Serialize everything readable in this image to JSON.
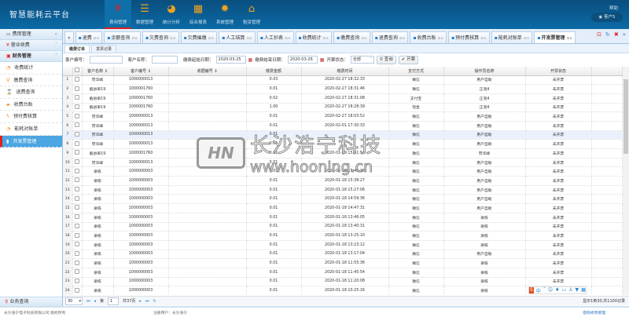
{
  "app": {
    "title": "智慧能耗云平台",
    "help": "帮助",
    "user": "客户5"
  },
  "nav": [
    {
      "label": "费用管理",
      "icon": "yen-icon",
      "glyph": "¥",
      "active": true
    },
    {
      "label": "数据管理",
      "icon": "database-icon",
      "glyph": "☰"
    },
    {
      "label": "统计分析",
      "icon": "pie-chart-icon",
      "glyph": "◕"
    },
    {
      "label": "综合报表",
      "icon": "table-icon",
      "glyph": "▦"
    },
    {
      "label": "系统管理",
      "icon": "gear-icon",
      "glyph": "✹"
    },
    {
      "label": "租赁管理",
      "icon": "home-icon",
      "glyph": "⌂"
    }
  ],
  "sidebar": {
    "header": "费用管理",
    "groups": [
      {
        "label": "营业收费"
      },
      {
        "label": "财务管理"
      }
    ],
    "items": [
      {
        "label": "收费统计"
      },
      {
        "label": "缴费查询"
      },
      {
        "label": "退费查询"
      },
      {
        "label": "收费台账"
      },
      {
        "label": "预付费核算"
      },
      {
        "label": "能耗对账单"
      },
      {
        "label": "开发票管理",
        "active": true
      }
    ],
    "bottom": "业务查询"
  },
  "tabs": [
    {
      "label": "退费"
    },
    {
      "label": "余额查询"
    },
    {
      "label": "欠费查询"
    },
    {
      "label": "欠费催缴"
    },
    {
      "label": "人工结算"
    },
    {
      "label": "人工抄表"
    },
    {
      "label": "收费统计"
    },
    {
      "label": "缴费查询"
    },
    {
      "label": "退费查询"
    },
    {
      "label": "收费台账"
    },
    {
      "label": "预付费核算"
    },
    {
      "label": "能耗对账单"
    },
    {
      "label": "开发票管理",
      "active": true
    }
  ],
  "subtabs": [
    {
      "label": "缴费订单",
      "active": true
    },
    {
      "label": "发票记录"
    }
  ],
  "filter": {
    "customer_no_label": "客户编号：",
    "customer_no": "",
    "customer_name_label": "客户名称：",
    "customer_name": "",
    "start_label": "缴费起始日期：",
    "start": "2020-03-25",
    "end_label": "缴费结束日期：",
    "end": "2020-03-26",
    "status_label": "开票状态：",
    "status": "全部",
    "query": "查询",
    "invoice": "开票"
  },
  "table": {
    "columns": [
      "客户名称 ↕",
      "客户编号 ↕",
      "收据编号 ↕",
      "缴费金额",
      "缴费时间",
      "支付方式",
      "操作员名称",
      "开票状态"
    ],
    "rows": [
      [
        "赞华峰",
        "1000000013",
        "",
        "0.03",
        "2020-02-27 18:32:33",
        "微信",
        "用户自助",
        "未开票"
      ],
      [
        "截进单19",
        "1000001760",
        "",
        "0.01",
        "2020-02-27 18:31:46",
        "微信",
        "正泡4",
        "未开票"
      ],
      [
        "截进单19",
        "1000001760",
        "",
        "0.02",
        "2020-02-27 18:31:08",
        "支付宝",
        "正泡4",
        "未开票"
      ],
      [
        "截进单19",
        "1000001760",
        "",
        "1.00",
        "2020-02-27 18:28:39",
        "现金",
        "正泡4",
        "未开票"
      ],
      [
        "赞华峰",
        "1000000013",
        "",
        "0.01",
        "2020-02-27 18:03:52",
        "微信",
        "用户自助",
        "未开票"
      ],
      [
        "赞华峰",
        "1000000013",
        "",
        "0.01",
        "2020-02-01 17:30:33",
        "微信",
        "用户自助",
        "未开票"
      ],
      [
        "赞华峰",
        "1000000013",
        "",
        "0.01",
        "",
        "微信",
        "用户自助",
        "未开票"
      ],
      [
        "赞华峰",
        "1000000013",
        "",
        "0.01",
        "",
        "微信",
        "用户自助",
        "未开票"
      ],
      [
        "截进单19",
        "1000001760",
        "",
        "0.01",
        "2020-01-29 15:41:54",
        "微信",
        "赞华峰",
        "未开票"
      ],
      [
        "赞华峰",
        "1000000013",
        "",
        "0.01",
        "",
        "微信",
        "用户自助",
        "未开票"
      ],
      [
        "梁栋",
        "1000000003",
        "",
        "0.01",
        "2020-01-18 15:46:36",
        "微信",
        "用户自助",
        "未开票"
      ],
      [
        "梁栋",
        "1000000003",
        "",
        "0.01",
        "2020-01-18 15:38:27",
        "微信",
        "用户自助",
        "未开票"
      ],
      [
        "梁栋",
        "1000000003",
        "",
        "0.01",
        "2020-01-18 15:27:06",
        "微信",
        "用户自助",
        "未开票"
      ],
      [
        "梁栋",
        "1000000003",
        "",
        "0.01",
        "2020-01-18 14:59:36",
        "微信",
        "用户自助",
        "未开票"
      ],
      [
        "梁栋",
        "1000000003",
        "",
        "0.01",
        "2020-01-18 14:47:31",
        "微信",
        "用户自助",
        "未开票"
      ],
      [
        "梁栋",
        "1000000003",
        "",
        "0.01",
        "2020-01-18 13:46:05",
        "微信",
        "梁栋",
        "未开票"
      ],
      [
        "梁栋",
        "1000000003",
        "",
        "0.01",
        "2020-01-18 13:40:31",
        "微信",
        "梁栋",
        "未开票"
      ],
      [
        "梁栋",
        "1000000003",
        "",
        "0.01",
        "2020-01-18 13:25:10",
        "微信",
        "梁栋",
        "未开票"
      ],
      [
        "梁栋",
        "1000000003",
        "",
        "0.01",
        "2020-01-18 13:23:12",
        "微信",
        "梁栋",
        "未开票"
      ],
      [
        "梁栋",
        "1000000003",
        "",
        "0.01",
        "2020-01-18 13:17:04",
        "微信",
        "用户自助",
        "未开票"
      ],
      [
        "梁栋",
        "1000000003",
        "",
        "0.01",
        "2020-01-18 11:55:36",
        "微信",
        "梁栋",
        "未开票"
      ],
      [
        "梁栋",
        "1000000003",
        "",
        "0.01",
        "2020-01-18 11:45:54",
        "微信",
        "梁栋",
        "未开票"
      ],
      [
        "梁栋",
        "1000000003",
        "",
        "0.01",
        "2020-01-18 11:20:08",
        "微信",
        "梁栋",
        "未开票"
      ],
      [
        "梁栋",
        "1000000003",
        "",
        "0.01",
        "2020-01-18 10:25:16",
        "微信",
        "梁栋",
        "未开票"
      ]
    ]
  },
  "pager": {
    "page_size": "30",
    "page_label": "第",
    "page": "1",
    "total_pages": "共37页",
    "info": "显示1到30,共1100记录"
  },
  "footer": {
    "copyright": "长沙浩宁电子科技有限公司 版权所有",
    "registered": "注册用户：长沙浩宁",
    "link": "密码修改管理"
  },
  "watermark": {
    "logo": "HN",
    "name": "长沙浩宁科技",
    "url": "www.hooning.cn"
  },
  "colors": {
    "header": "#0b5a90",
    "accent": "#e02020",
    "active_item": "#4ba6e2",
    "icon": "#f3a31c"
  }
}
